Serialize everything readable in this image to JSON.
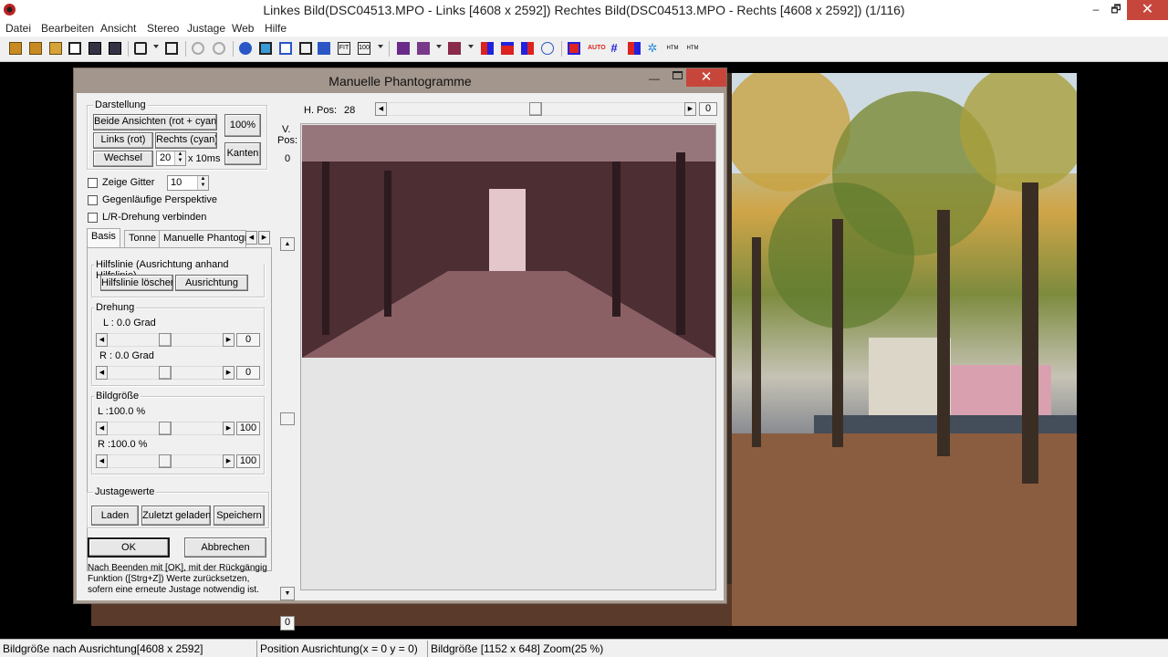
{
  "window": {
    "title": "Linkes Bild(DSC04513.MPO - Links [4608 x 2592]) Rechtes Bild(DSC04513.MPO - Rechts [4608 x 2592])  (1/116)",
    "minimize": "–",
    "maximize": "🗗",
    "close": "✕"
  },
  "menu": [
    "Datei",
    "Bearbeiten",
    "Ansicht",
    "Stereo",
    "Justage",
    "Web",
    "Hilfe"
  ],
  "dialog": {
    "title": "Manuelle Phantogramme",
    "close": "✕",
    "darstellung": {
      "title": "Darstellung",
      "both": "Beide Ansichten (rot + cyan)",
      "left": "Links (rot)",
      "right": "Rechts (cyan)",
      "wechsel": "Wechsel",
      "interval": "20",
      "interval_unit": "x 10ms",
      "zoom100": "100%",
      "kanten": "Kanten"
    },
    "zeige_gitter": "Zeige Gitter",
    "grid_value": "10",
    "gegenlaeufig": "Gegenläufige Perspektive",
    "lr_drehung": "L/R-Drehung verbinden",
    "tabs": [
      "Basis",
      "Tonne",
      "Manuelle Phantogr"
    ],
    "hilfslinie": {
      "title": "Hilfslinie (Ausrichtung anhand Hilfslinie)",
      "delete": "Hilfslinie löschen",
      "align": "Ausrichtung"
    },
    "drehung": {
      "title": "Drehung",
      "l_label": "L : 0.0 Grad",
      "l_value": "0",
      "l_level": 0.5,
      "r_label": "R : 0.0 Grad",
      "r_value": "0",
      "r_level": 0.5
    },
    "bildgroesse": {
      "title": "Bildgröße",
      "l_label": "L :100.0 %",
      "l_value": "100",
      "l_level": 0.5,
      "r_label": "R :100.0 %",
      "r_value": "100",
      "r_level": 0.5
    },
    "justagewerte": {
      "title": "Justagewerte",
      "load": "Laden",
      "last": "Zuletzt geladen",
      "save": "Speichern"
    },
    "ok": "OK",
    "cancel": "Abbrechen",
    "note": "Nach Beenden mit [OK], mit der Rückgängig Funktion ([Strg+Z]) Werte zurücksetzen, sofern eine erneute Justage notwendig ist.",
    "hpos_label": "H. Pos:",
    "hpos_value": "28",
    "hpos_box": "0",
    "vpos_label_1": "V.",
    "vpos_label_2": "Pos:",
    "vpos_value": "0",
    "vpos_box": "0"
  },
  "status": {
    "cell1": "Bildgröße nach Ausrichtung[4608 x 2592]",
    "cell2": "Position Ausrichtung(x = 0 y = 0)",
    "cell3": "Bildgröße [1152 x 648]  Zoom(25 %)"
  },
  "colors": {
    "dialog_title": "#a3968d",
    "close_red": "#c7463c"
  }
}
